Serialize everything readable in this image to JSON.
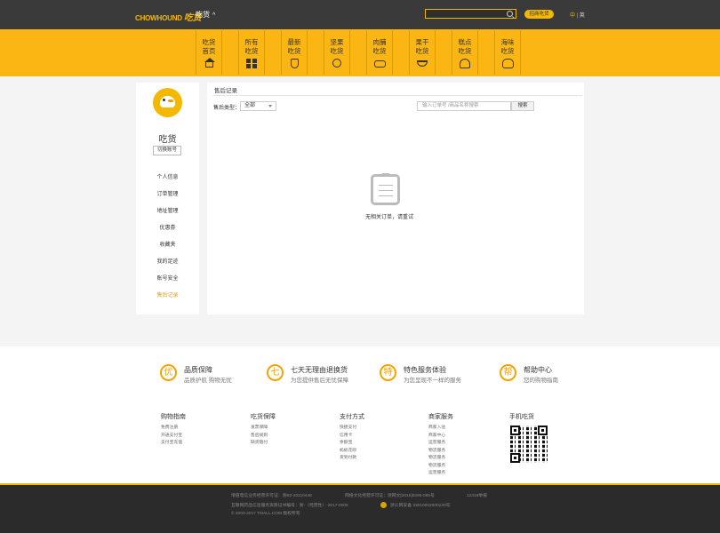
{
  "topbar": {
    "logo_text": "CHOWHOUND",
    "logo_cn": "吃货",
    "site_name": "吃货",
    "site_chevron": "^",
    "coop_button": "招商吃货",
    "lang_cn": "中",
    "lang_sep": "|",
    "lang_en": "英"
  },
  "nav": [
    {
      "line1": "吃货",
      "line2": "首页",
      "icon": "home-icon"
    },
    {
      "line1": "所有",
      "line2": "吃货",
      "icon": "grid-icon"
    },
    {
      "line1": "最新",
      "line2": "吃货",
      "icon": "new-badge-icon"
    },
    {
      "line1": "坚果",
      "line2": "吃货",
      "icon": "nut-icon"
    },
    {
      "line1": "肉脯",
      "line2": "吃货",
      "icon": "meat-icon"
    },
    {
      "line1": "果干",
      "line2": "吃货",
      "icon": "dried-fruit-icon"
    },
    {
      "line1": "糕点",
      "line2": "吃货",
      "icon": "cake-icon"
    },
    {
      "line1": "海味",
      "line2": "吃货",
      "icon": "seafood-icon"
    }
  ],
  "sidebar": {
    "username": "吃货",
    "switch_account": "切换账号",
    "items": [
      "个人信息",
      "订单管理",
      "地址管理",
      "优惠券",
      "收藏夹",
      "我的足迹",
      "账号安全",
      "售后记录"
    ],
    "active_index": 7
  },
  "main": {
    "title": "售后记录",
    "type_label": "售后类型：",
    "type_value": "全部",
    "search_placeholder": "输入订单号 /商品名称搜索",
    "search_button": "搜索",
    "empty_text": "无相关订单，请重试"
  },
  "services": [
    {
      "icon": "优",
      "title": "品质保障",
      "sub": "品质护航 购物无忧"
    },
    {
      "icon": "七",
      "title": "七天无理由退换货",
      "sub": "为您提供售后无忧保障"
    },
    {
      "icon": "特",
      "title": "特色服务体验",
      "sub": "为您呈现不一样的服务"
    },
    {
      "icon": "帮",
      "title": "帮助中心",
      "sub": "您的购物指南"
    }
  ],
  "footer_cols": [
    {
      "title": "购物指南",
      "links": [
        "免费注册",
        "开通支付宝",
        "支付宝充值"
      ]
    },
    {
      "title": "吃货保障",
      "links": [
        "发票保障",
        "售后规则",
        "缺货赔付"
      ]
    },
    {
      "title": "支付方式",
      "links": [
        "快捷支付",
        "信用卡",
        "余额宝",
        "蚂蚁花呗",
        "货到付款"
      ]
    },
    {
      "title": "商家服务",
      "links": [
        "商家入驻",
        "商家中心",
        "运营服务",
        "物流服务",
        "物流服务",
        "物流服务",
        "运营服务"
      ]
    },
    {
      "title": "手机吃货",
      "links": []
    }
  ],
  "bottom": {
    "line1a": "增值电信业务经营许可证：浙B2-20110446",
    "line1b": "网络文化经营许可证：浙网文[2015]0295-065号",
    "line1c": "12318举报",
    "line2a": "互联网药品信息服务资质证书编号：浙-（经营性）-2017-0005",
    "line2b": "浙公网安备 33010002000120号",
    "line3": "© 2003-2017 TMALL.COM 版权所有"
  },
  "colors": {
    "accent": "#fbb614",
    "dark": "#3a3a3a",
    "active_menu": "#e8a200"
  }
}
